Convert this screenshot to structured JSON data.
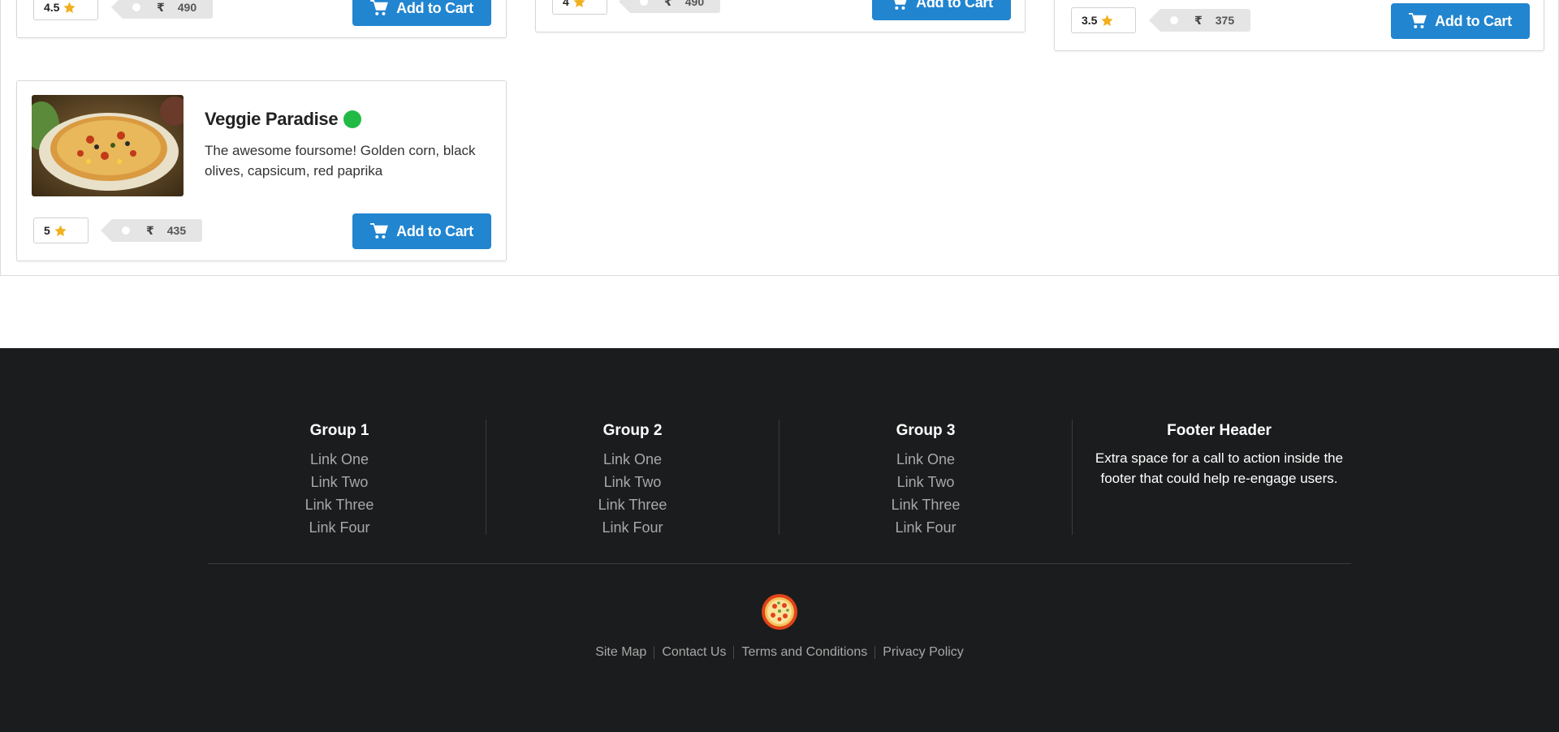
{
  "colors": {
    "accent": "#2185d0",
    "veg_indicator": "#21ba45",
    "star": "#f2b01e",
    "footer_bg": "#1b1c1d"
  },
  "cards": [
    {
      "rating": "4.5",
      "price": "490",
      "currency": "₹",
      "cart_label": "Add to Cart"
    },
    {
      "rating": "4",
      "price": "490",
      "currency": "₹",
      "cart_label": "Add to Cart"
    },
    {
      "rating": "3.5",
      "price": "375",
      "currency": "₹",
      "cart_label": "Add to Cart"
    },
    {
      "name": "Veggie Paradise",
      "description": "The awesome foursome! Golden corn, black olives, capsicum, red paprika",
      "rating": "5",
      "price": "435",
      "currency": "₹",
      "cart_label": "Add to Cart",
      "veg": true
    }
  ],
  "footer": {
    "groups": [
      {
        "title": "Group 1",
        "links": [
          "Link One",
          "Link Two",
          "Link Three",
          "Link Four"
        ]
      },
      {
        "title": "Group 2",
        "links": [
          "Link One",
          "Link Two",
          "Link Three",
          "Link Four"
        ]
      },
      {
        "title": "Group 3",
        "links": [
          "Link One",
          "Link Two",
          "Link Three",
          "Link Four"
        ]
      }
    ],
    "cta": {
      "title": "Footer Header",
      "text": "Extra space for a call to action inside the footer that could help re-engage users."
    },
    "bottom_links": [
      "Site Map",
      "Contact Us",
      "Terms and Conditions",
      "Privacy Policy"
    ]
  }
}
